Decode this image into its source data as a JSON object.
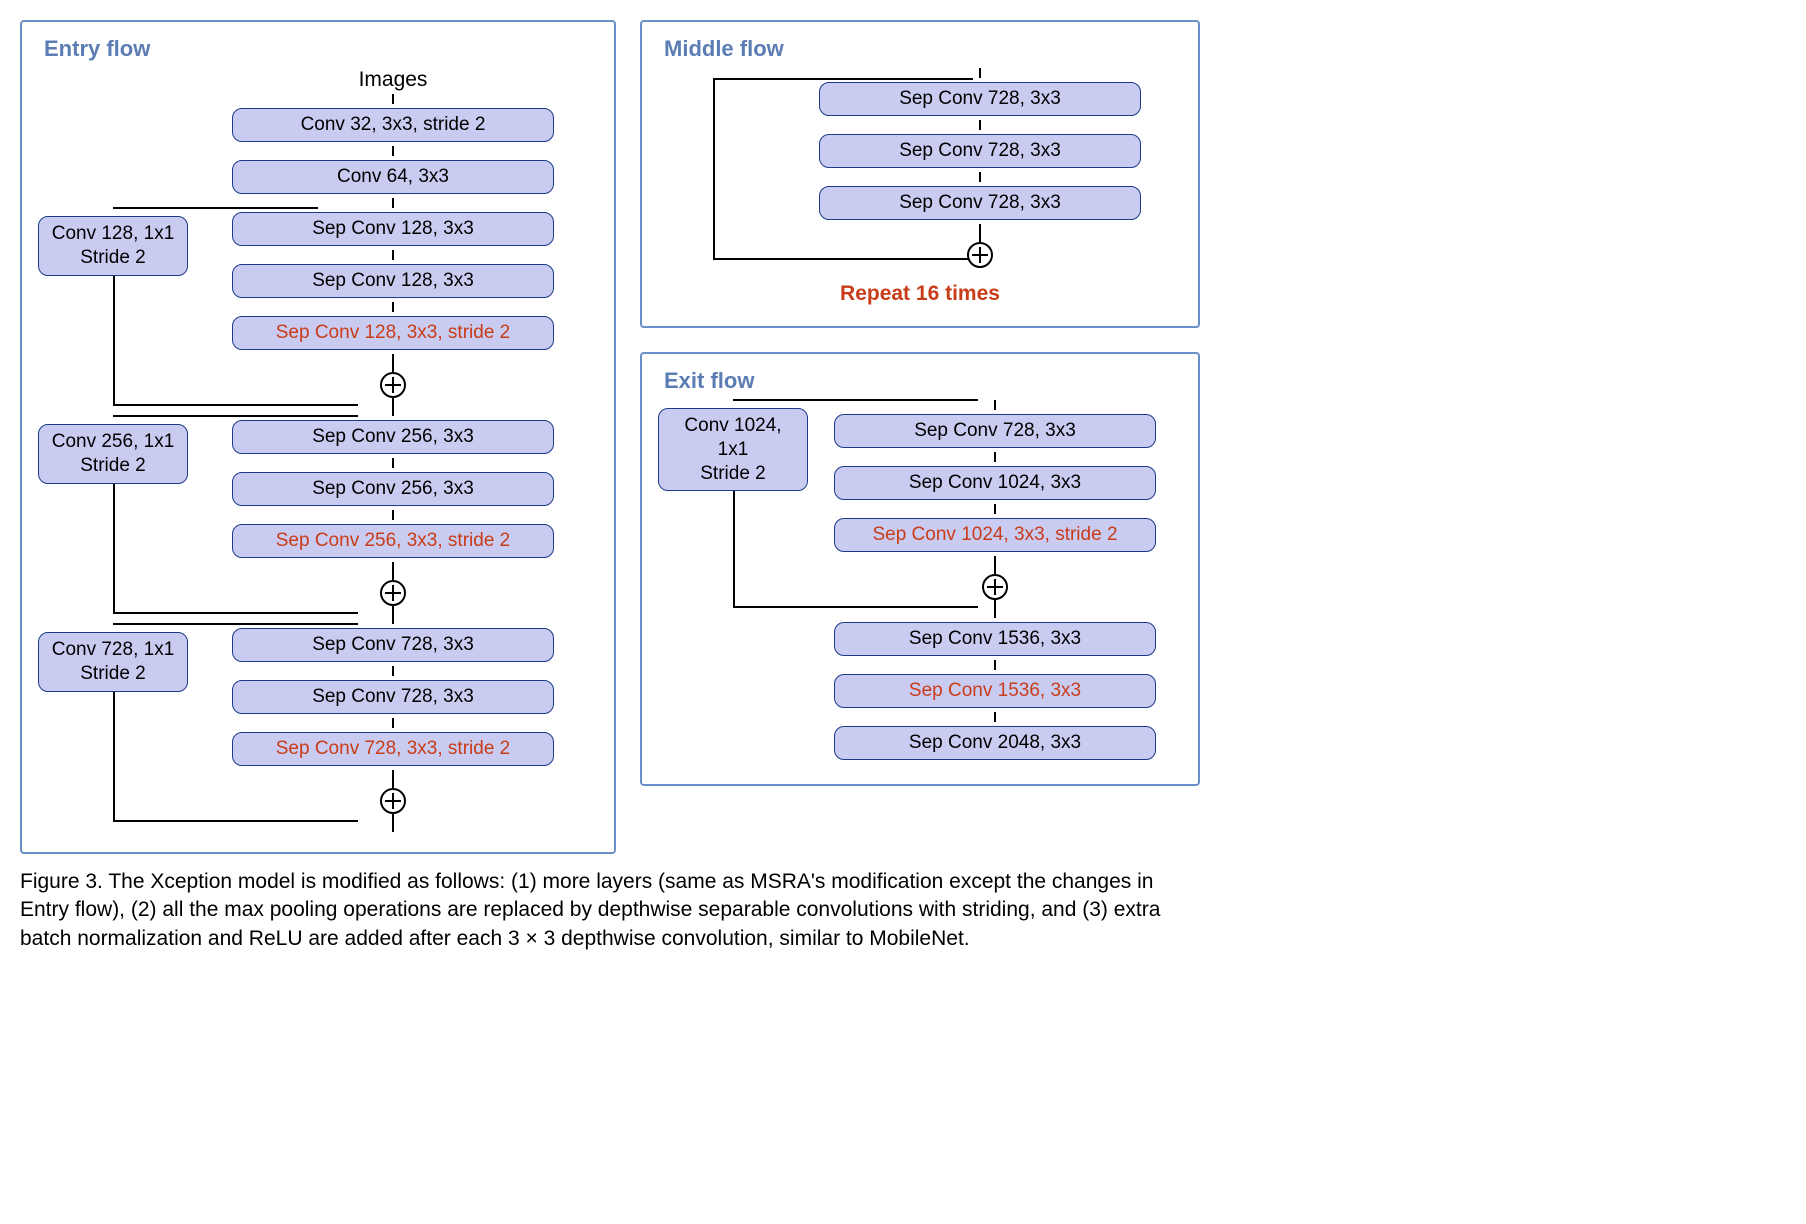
{
  "entry": {
    "title": "Entry  flow",
    "input": "Images",
    "stem": [
      "Conv 32, 3x3, stride 2",
      "Conv 64, 3x3"
    ],
    "blocks": [
      {
        "side": "Conv 128, 1x1\nStride 2",
        "layers": [
          {
            "text": "Sep Conv 128, 3x3",
            "hl": false
          },
          {
            "text": "Sep Conv 128, 3x3",
            "hl": false
          },
          {
            "text": "Sep Conv 128, 3x3, stride 2",
            "hl": true
          }
        ]
      },
      {
        "side": "Conv 256, 1x1\nStride 2",
        "layers": [
          {
            "text": "Sep Conv 256, 3x3",
            "hl": false
          },
          {
            "text": "Sep Conv 256, 3x3",
            "hl": false
          },
          {
            "text": "Sep Conv 256, 3x3, stride 2",
            "hl": true
          }
        ]
      },
      {
        "side": "Conv 728, 1x1\nStride 2",
        "layers": [
          {
            "text": "Sep Conv 728, 3x3",
            "hl": false
          },
          {
            "text": "Sep Conv 728, 3x3",
            "hl": false
          },
          {
            "text": "Sep Conv 728, 3x3, stride 2",
            "hl": true
          }
        ]
      }
    ]
  },
  "middle": {
    "title": "Middle  flow",
    "layers": [
      "Sep Conv 728, 3x3",
      "Sep Conv 728, 3x3",
      "Sep Conv 728, 3x3"
    ],
    "repeat": "Repeat 16 times"
  },
  "exit": {
    "title": "Exit  flow",
    "block": {
      "side": "Conv 1024, 1x1\nStride 2",
      "layers": [
        {
          "text": "Sep Conv 728, 3x3",
          "hl": false
        },
        {
          "text": "Sep Conv 1024, 3x3",
          "hl": false
        },
        {
          "text": "Sep Conv 1024, 3x3, stride 2",
          "hl": true
        }
      ]
    },
    "tail": [
      {
        "text": "Sep Conv 1536, 3x3",
        "hl": false
      },
      {
        "text": "Sep Conv 1536, 3x3",
        "hl": true
      },
      {
        "text": "Sep Conv 2048, 3x3",
        "hl": false
      }
    ]
  },
  "caption": "Figure 3. The Xception model is modified as follows: (1) more layers (same as MSRA's modification except the changes in Entry flow), (2) all the max pooling operations are replaced by depthwise separable convolutions with striding, and (3) extra batch normalization and ReLU are added after each 3 × 3 depthwise convolution, similar to MobileNet."
}
